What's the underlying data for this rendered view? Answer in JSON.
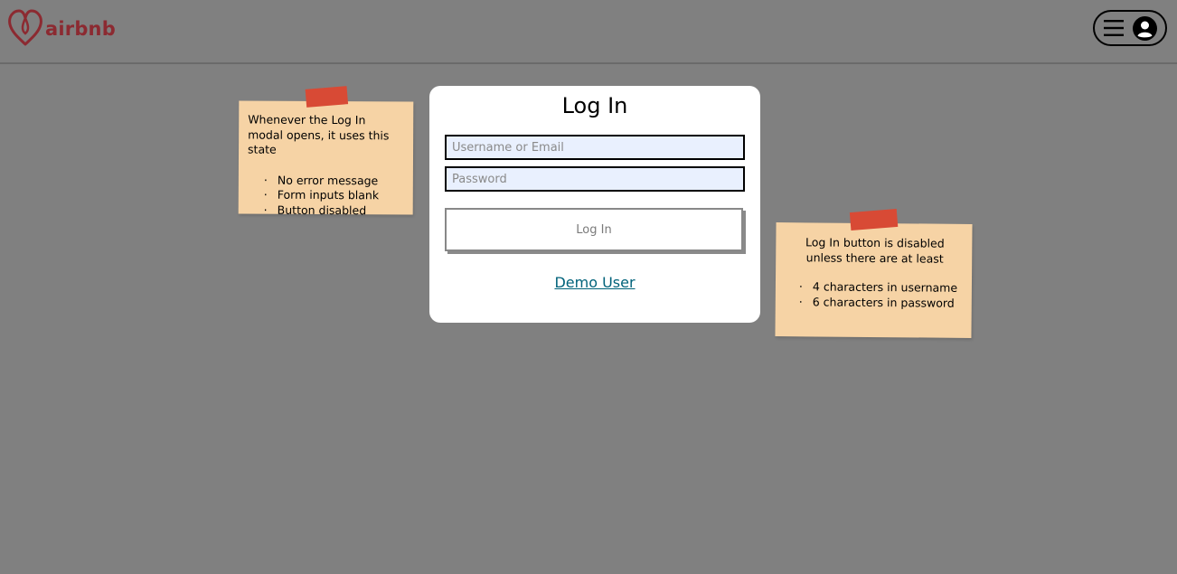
{
  "header": {
    "logo_text": "airbnb",
    "logo_icon": "airbnb-belo-icon",
    "profile_menu_icons": [
      "hamburger-menu-icon",
      "user-avatar-icon"
    ]
  },
  "modal": {
    "title": "Log In",
    "username": {
      "placeholder": "Username or Email",
      "value": ""
    },
    "password": {
      "placeholder": "Password",
      "value": ""
    },
    "login_button_label": "Log In",
    "login_button_disabled": true,
    "demo_user_label": "Demo User"
  },
  "notes": {
    "left": {
      "text": "Whenever the Log In modal opens, it uses this state",
      "items": [
        "No error message",
        "Form inputs blank",
        "Button disabled"
      ]
    },
    "right": {
      "text": "Log In button is disabled unless there are at least",
      "items": [
        "4 characters in username",
        "6 characters in password"
      ]
    }
  },
  "colors": {
    "background": "#808080",
    "brand": "#8c2a31",
    "note": "#f6d3a5",
    "tape": "#d84a35",
    "link": "#00627a",
    "input_bg": "#e9f0fe"
  }
}
